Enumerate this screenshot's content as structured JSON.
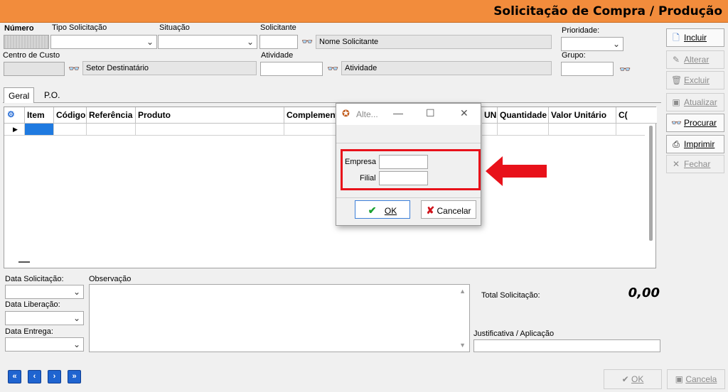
{
  "window": {
    "title": "Solicitação de Compra / Produção"
  },
  "fields": {
    "numero_label": "Número",
    "tipo_label": "Tipo Solicitação",
    "situacao_label": "Situação",
    "solicitante_label": "Solicitante",
    "solicitante_name": "Nome Solicitante",
    "prioridade_label": "Prioridade:",
    "centro_label": "Centro de Custo",
    "setor_destinatario": "Setor Destinatário",
    "atividade_label": "Atividade",
    "atividade_name": "Atividade",
    "grupo_label": "Grupo:"
  },
  "tabs": [
    {
      "label": "Geral"
    },
    {
      "label": "P.O."
    }
  ],
  "grid": {
    "columns": [
      "Item",
      "Código",
      "Referência",
      "Produto",
      "Complement",
      "UN",
      "Quantidade",
      "Valor Unitário",
      "C("
    ]
  },
  "sidebar": {
    "buttons": [
      {
        "label": "Incluir",
        "enabled": true
      },
      {
        "label": "Alterar",
        "enabled": false
      },
      {
        "label": "Excluir",
        "enabled": false
      },
      {
        "label": "Atualizar",
        "enabled": false
      },
      {
        "label": "Procurar",
        "enabled": true
      },
      {
        "label": "Imprimir",
        "enabled": true
      },
      {
        "label": "Fechar",
        "enabled": false
      }
    ]
  },
  "bottom": {
    "data_solicitacao_label": "Data Solicitação:",
    "data_liberacao_label": "Data Liberação:",
    "data_entrega_label": "Data Entrega:",
    "observacao_label": "Observação",
    "total_label": "Total Solicitação:",
    "total_value": "0,00",
    "justificativa_label": "Justificativa / Aplicação",
    "ok_label": "OK",
    "cancel_label": "Cancela"
  },
  "dialog": {
    "title": "Alte...",
    "empresa_label": "Empresa",
    "filial_label": "Filial",
    "empresa_value": "",
    "filial_value": "",
    "ok_label": "OK",
    "cancel_label": "Cancelar"
  },
  "colors": {
    "title_bar": "#f28c3c",
    "highlight": "#e8111a",
    "nav_blue": "#1f64d0"
  }
}
